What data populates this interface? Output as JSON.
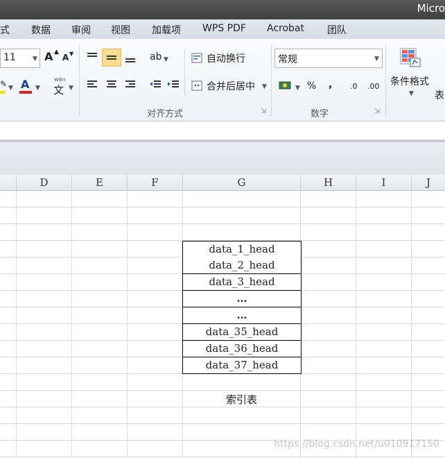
{
  "window": {
    "title": "Micro"
  },
  "menu": [
    "式",
    "数据",
    "审阅",
    "视图",
    "加载项",
    "WPS PDF",
    "Acrobat",
    "团队"
  ],
  "ribbon": {
    "font_size": "11",
    "grow_font_label": "A",
    "shrink_font_label": "A",
    "font_color_label": "A",
    "phonetic_label": "文",
    "phonetic_small": "wén",
    "wrap_text_label": "自动换行",
    "merge_center_label": "合并后居中",
    "number_format": "常规",
    "percent_label": "%",
    "comma_label": ",",
    "inc_decimal_label": ".0",
    "dec_decimal_label": ".00",
    "conditional_format_label": "条件格式",
    "table_label_partial": "表",
    "alignment_group_label": "对齐方式",
    "number_group_label": "数字"
  },
  "columns": [
    "D",
    "E",
    "F",
    "G",
    "H",
    "I",
    "J"
  ],
  "table_cells": [
    "data_1_head",
    "data_2_head",
    "data_3_head",
    "…",
    "…",
    "data_35_head",
    "data_36_head",
    "data_37_head"
  ],
  "caption": "索引表",
  "watermark": "https://blog.csdn.net/u010917150",
  "colors": {
    "font_color_bar": "#e01f1f",
    "highlight_bar": "#f2e200",
    "active_button": "#f7dd8f"
  }
}
